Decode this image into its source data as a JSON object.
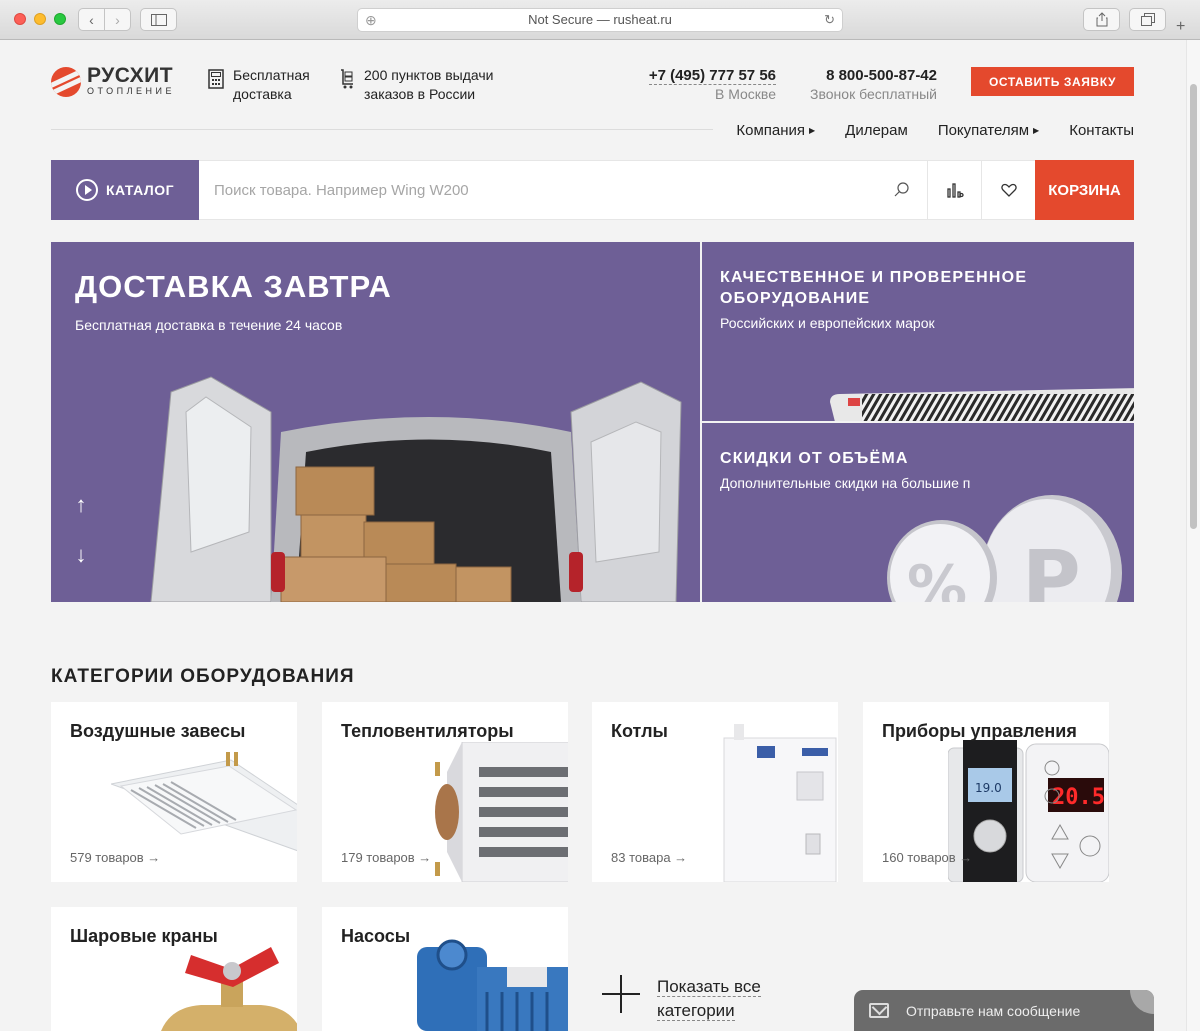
{
  "browser": {
    "address": "Not Secure — rusheat.ru"
  },
  "header": {
    "logo_name": "РУСХИТ",
    "logo_sub": "ОТОПЛЕНИЕ",
    "delivery_line1": "Бесплатная",
    "delivery_line2": "доставка",
    "points_line1": "200 пунктов выдачи",
    "points_line2": "заказов в России",
    "phone1": "+7 (495) 777 57 56",
    "phone1_caption": "В Москве",
    "phone2": "8 800-500-87-42",
    "phone2_caption": "Звонок бесплатный",
    "cta_label": "ОСТАВИТЬ ЗАЯВКУ"
  },
  "nav": {
    "items": [
      {
        "label": "Компания",
        "has_submenu": true
      },
      {
        "label": "Дилерам",
        "has_submenu": false
      },
      {
        "label": "Покупателям",
        "has_submenu": true
      },
      {
        "label": "Контакты",
        "has_submenu": false
      }
    ]
  },
  "search": {
    "catalog_label": "КАТАЛОГ",
    "placeholder": "Поиск товара. Например Wing W200",
    "cart_label": "КОРЗИНА"
  },
  "banners": {
    "main_title": "ДОСТАВКА ЗАВТРА",
    "main_sub": "Бесплатная доставка в течение 24 часов",
    "quality_title": "КАЧЕСТВЕННОЕ И ПРОВЕРЕННОЕ ОБОРУДОВАНИЕ",
    "quality_sub": "Российских и европейских марок",
    "discount_title": "СКИДКИ ОТ ОБЪЁМА",
    "discount_sub": "Дополнительные скидки на большие п"
  },
  "categories": {
    "title": "КАТЕГОРИИ ОБОРУДОВАНИЯ",
    "items": [
      {
        "name": "Воздушные завесы",
        "count": "579 товаров →"
      },
      {
        "name": "Тепловентиляторы",
        "count": "179 товаров →"
      },
      {
        "name": "Котлы",
        "count": "83 товара →"
      },
      {
        "name": "Приборы управления",
        "count": "160 товаров →"
      },
      {
        "name": "Шаровые краны",
        "count": ""
      },
      {
        "name": "Насосы",
        "count": ""
      }
    ],
    "show_all_line1": "Показать все",
    "show_all_line2": "категории",
    "display_value": "20.5",
    "thermostat_value": "19.0"
  },
  "chat": {
    "label": "Отправьте нам сообщение"
  },
  "colors": {
    "accent": "#e4492d",
    "brand_purple": "#6e5f96"
  }
}
